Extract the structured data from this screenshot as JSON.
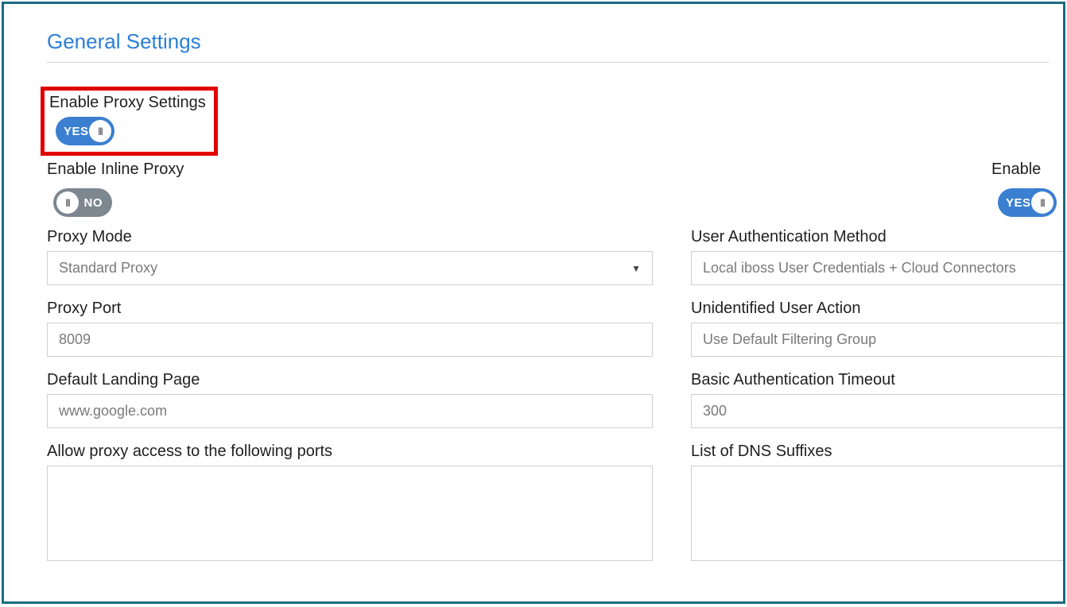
{
  "section_title": "General Settings",
  "enable_proxy": {
    "label": "Enable Proxy Settings",
    "state": "YES"
  },
  "enable_inline_proxy": {
    "label": "Enable Inline Proxy",
    "state": "NO"
  },
  "enable_right": {
    "label": "Enable",
    "state": "YES"
  },
  "left": {
    "proxy_mode": {
      "label": "Proxy Mode",
      "value": "Standard Proxy"
    },
    "proxy_port": {
      "label": "Proxy Port",
      "value": "8009"
    },
    "landing_page": {
      "label": "Default Landing Page",
      "value": "www.google.com"
    },
    "allow_ports": {
      "label": "Allow proxy access to the following ports",
      "value": ""
    }
  },
  "right": {
    "auth_method": {
      "label": "User Authentication Method",
      "value": "Local iboss User Credentials + Cloud Connectors"
    },
    "unidentified_user": {
      "label": "Unidentified User Action",
      "value": "Use Default Filtering Group"
    },
    "basic_auth_timeout": {
      "label": "Basic Authentication Timeout",
      "value": "300"
    },
    "dns_suffixes": {
      "label": "List of DNS Suffixes",
      "value": ""
    }
  }
}
